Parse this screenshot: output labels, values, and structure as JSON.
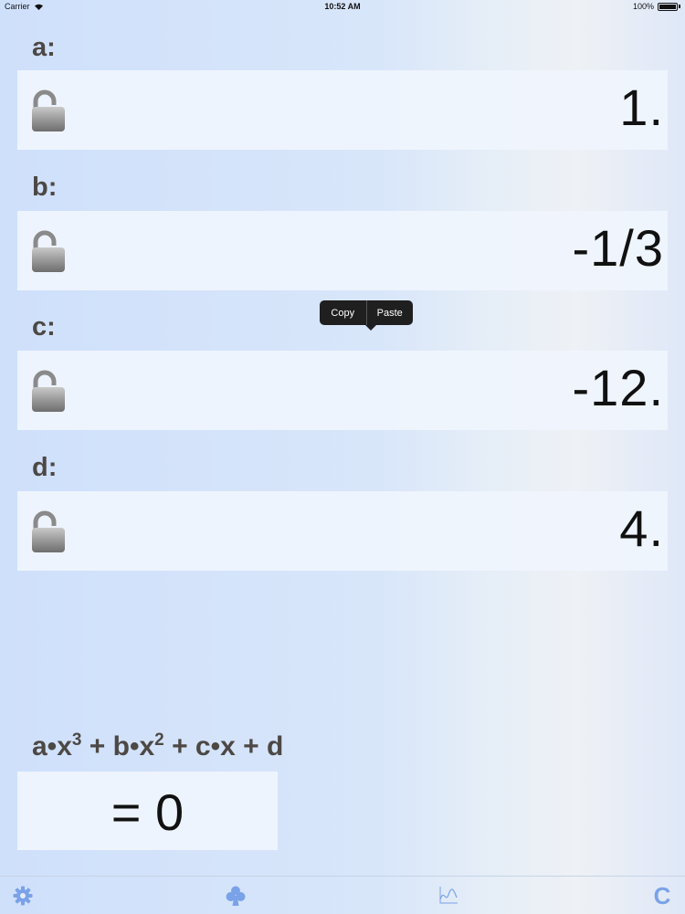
{
  "status_bar": {
    "carrier": "Carrier",
    "time": "10:52 AM",
    "battery": "100%"
  },
  "coefficients": [
    {
      "label": "a:",
      "value": "1.",
      "lock_icon": "lock-open-icon"
    },
    {
      "label": "b:",
      "value": "-1/3",
      "lock_icon": "lock-open-icon"
    },
    {
      "label": "c:",
      "value": "-12.",
      "lock_icon": "lock-open-icon"
    },
    {
      "label": "d:",
      "value": "4.",
      "lock_icon": "lock-open-icon"
    }
  ],
  "context_menu": {
    "copy": "Copy",
    "paste": "Paste"
  },
  "equation": {
    "t1": "a•x",
    "p1": "3",
    "t2": " + b•x",
    "p2": "2",
    "t3": " + c•x + d"
  },
  "result": "= 0",
  "tab_bar": {
    "tabs": [
      "gear-icon",
      "club-icon",
      "graph-icon",
      "clear-icon"
    ],
    "clear_label": "C"
  },
  "colors": {
    "accent": "#7aa2e8",
    "label": "#4d4845",
    "popup": "#1f1f1f"
  }
}
